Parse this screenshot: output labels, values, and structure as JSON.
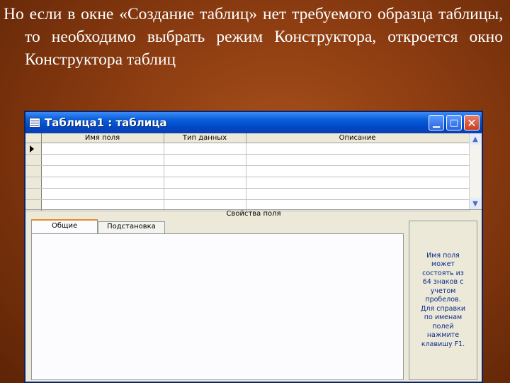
{
  "slide": {
    "text": "Но если в окне «Создание таблиц» нет требуемого образца таблицы, то необходимо выбрать режим Конструктора, откроется окно Конструктора таблиц"
  },
  "window": {
    "title": "Таблица1 : таблица",
    "icons": {
      "app": "table-icon",
      "minimize": "minimize-icon",
      "maximize": "maximize-icon",
      "close": "close-icon"
    },
    "columns": [
      "Имя поля",
      "Тип данных",
      "Описание"
    ],
    "properties_label": "Свойства поля",
    "tabs": [
      {
        "label": "Общие",
        "active": true
      },
      {
        "label": "Подстановка",
        "active": false
      }
    ],
    "help_text": "Имя поля может состоять из 64 знаков с учетом пробелов. Для справки по именам полей нажмите клавишу F1.",
    "colors": {
      "titlebar": "#0a5fd8",
      "close_button": "#c8401e",
      "help_text": "#0a2a8a",
      "active_tab_accent": "#e68b2c",
      "slide_background": "#8a3b10"
    }
  }
}
